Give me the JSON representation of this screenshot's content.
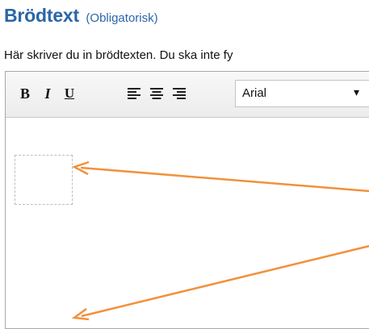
{
  "field": {
    "title": "Brödtext",
    "required_label": "(Obligatorisk)",
    "helper_text": "Här skriver du in brödtexten. Du ska inte fy"
  },
  "toolbar": {
    "bold_label": "B",
    "italic_label": "I",
    "underline_label": "U",
    "align_icons": [
      "align-left-icon",
      "align-center-icon",
      "align-right-icon"
    ],
    "font_select_value": "Arial"
  },
  "colors": {
    "title": "#2a66a8",
    "annotation_arrow": "#f2913b"
  }
}
